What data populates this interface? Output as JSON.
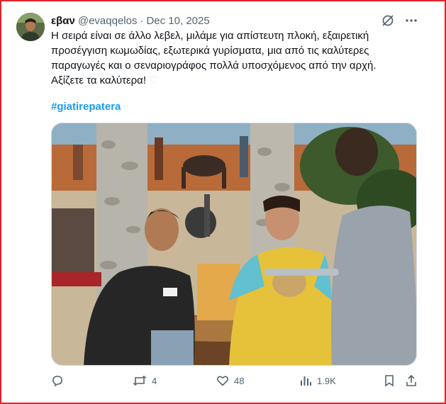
{
  "tweet": {
    "author_name": "εβαν",
    "handle": "@evaqqelos",
    "separator": "·",
    "date": "Dec 10, 2025",
    "lines": [
      "Η σειρά είναι σε άλλο λεβελ, μιλάμε για απίστευτη πλοκή, εξαιρετική",
      "προσέγγιση κωμωδίας, εξωτερικά γυρίσματα, μια από τις καλύτερες",
      "παραγωγές και ο σεναριογράφος πολλά υποσχόμενος από την αρχή.",
      "Αξίζετε τα καλύτερα! "
    ],
    "emoji": "♡",
    "hashtag": "#giatirepatera"
  },
  "actions": {
    "retweets": "4",
    "likes": "48",
    "views": "1.9K"
  },
  "icons": [
    "grok-icon",
    "more-icon",
    "reply-icon",
    "retweet-icon",
    "like-icon",
    "views-icon",
    "bookmark-icon",
    "share-icon"
  ],
  "colors": {
    "frame": "#e0242b",
    "hashtag": "#1d9bf0",
    "muted": "#536471"
  }
}
